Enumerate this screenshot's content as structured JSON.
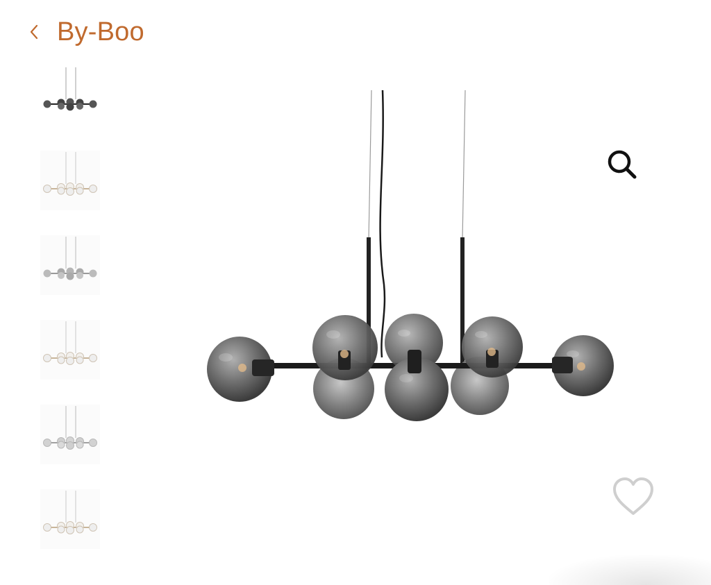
{
  "header": {
    "back_icon": "chevron-left-icon",
    "brand": "By-Boo"
  },
  "colors": {
    "accent": "#c06a2e",
    "icon": "#111111",
    "heart": "#cfcfcf"
  },
  "thumbnails": [
    {
      "variant": "black-smoke",
      "selected": true
    },
    {
      "variant": "gold-clear",
      "selected": false
    },
    {
      "variant": "silver-smoke",
      "selected": false
    },
    {
      "variant": "gold-clear",
      "selected": false
    },
    {
      "variant": "silver-clear",
      "selected": false
    },
    {
      "variant": "gold-clear",
      "selected": false
    }
  ],
  "actions": {
    "zoom_icon": "magnifier-icon",
    "favorite_icon": "heart-icon"
  }
}
